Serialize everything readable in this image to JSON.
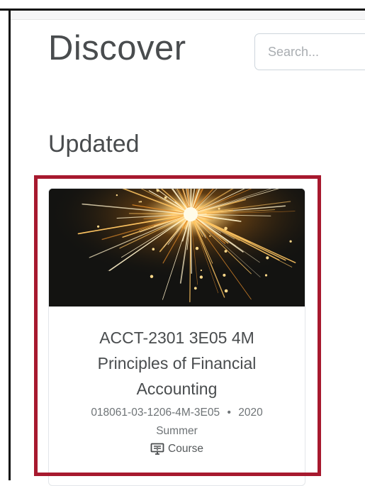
{
  "header": {
    "title": "Discover",
    "search_placeholder": "Search..."
  },
  "sections": [
    {
      "heading": "Updated",
      "cards": [
        {
          "image_icon": "sparkler-image",
          "title": "ACCT-2301 3E05 4M Principles of Financial Accounting",
          "code": "018061-03-1206-4M-3E05",
          "separator": "•",
          "term_part1": "2020",
          "term_part2": "Summer",
          "type_icon": "course-icon",
          "type_label": "Course"
        }
      ]
    }
  ],
  "colors": {
    "highlight": "#a7192e",
    "text": "#494c4e",
    "secondary_text": "#6e7376"
  }
}
